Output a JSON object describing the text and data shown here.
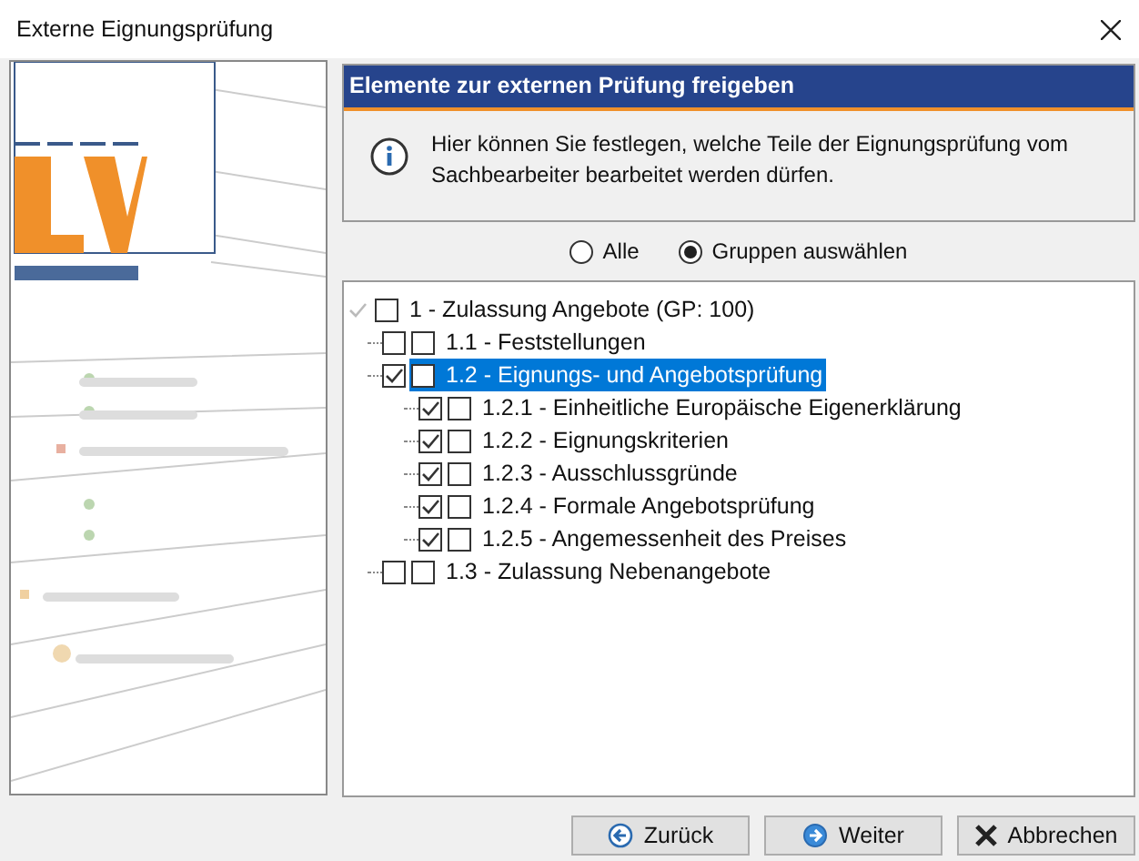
{
  "window": {
    "title": "Externe Eignungsprüfung"
  },
  "header": {
    "title": "Elemente zur externen Prüfung freigeben",
    "text": "Hier können Sie festlegen, welche Teile der Eignungsprüfung vom Sachbearbeiter bearbeitet werden dürfen."
  },
  "mode": [
    {
      "label": "Alle",
      "selected": false
    },
    {
      "label": "Gruppen auswählen",
      "selected": true
    }
  ],
  "tree": [
    {
      "label": "1 - Zulassung Angebote (GP: 100)",
      "checked": true,
      "disabled": true,
      "checked_2": false,
      "selected": false,
      "children": [
        {
          "label": "1.1 - Feststellungen",
          "checked": false,
          "disabled": false,
          "checked_2": false,
          "selected": false
        },
        {
          "label": "1.2 - Eignungs- und Angebotsprüfung",
          "checked": true,
          "disabled": false,
          "checked_2": false,
          "selected": true,
          "children": [
            {
              "label": "1.2.1 - Einheitliche Europäische Eigenerklärung",
              "checked": true,
              "disabled": false,
              "checked_2": false,
              "selected": false
            },
            {
              "label": "1.2.2 - Eignungskriterien",
              "checked": true,
              "disabled": false,
              "checked_2": false,
              "selected": false
            },
            {
              "label": "1.2.3 - Ausschlussgründe",
              "checked": true,
              "disabled": false,
              "checked_2": false,
              "selected": false
            },
            {
              "label": "1.2.4 - Formale Angebotsprüfung",
              "checked": true,
              "disabled": false,
              "checked_2": false,
              "selected": false
            },
            {
              "label": "1.2.5 - Angemessenheit des Preises",
              "checked": true,
              "disabled": false,
              "checked_2": false,
              "selected": false
            }
          ]
        },
        {
          "label": "1.3 - Zulassung Nebenangebote",
          "checked": false,
          "disabled": false,
          "checked_2": false,
          "selected": false
        }
      ]
    }
  ],
  "buttons": [
    {
      "label": "Zurück",
      "kind": "back"
    },
    {
      "label": "Weiter",
      "kind": "next"
    },
    {
      "label": "Abbrechen",
      "kind": "cancel"
    }
  ]
}
